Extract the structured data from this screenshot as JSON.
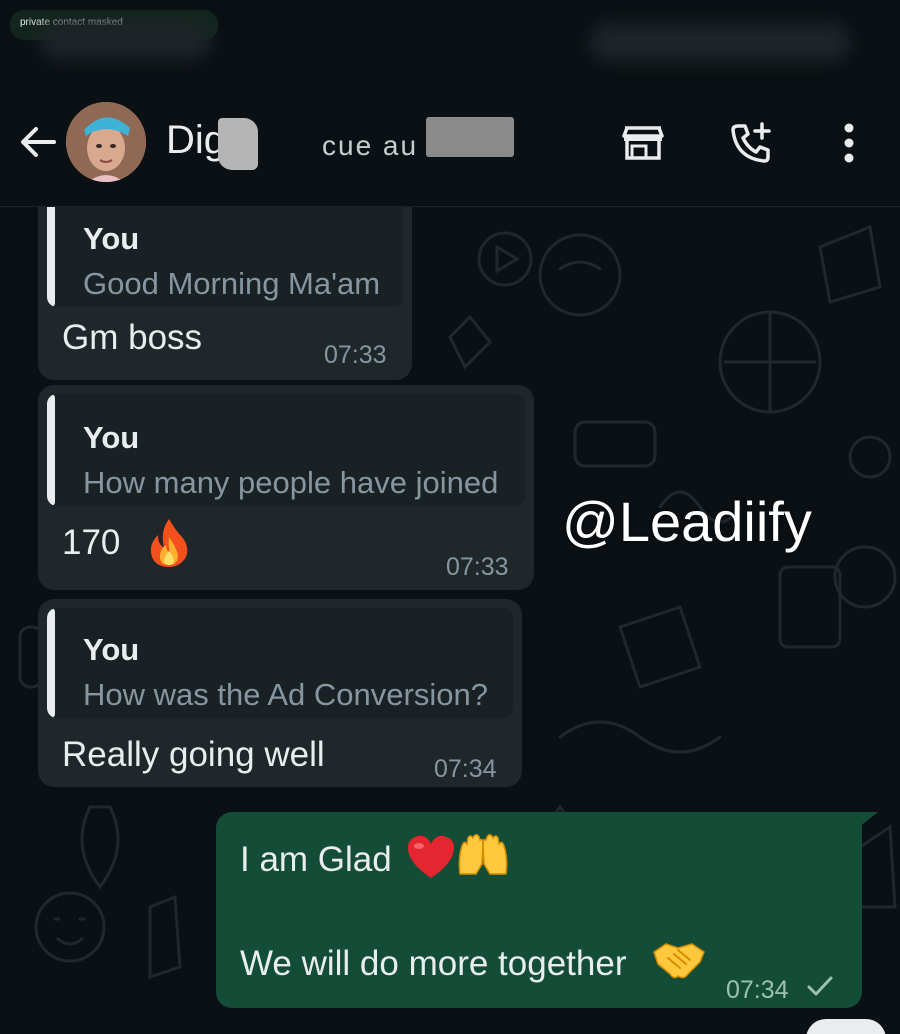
{
  "status_bar": {
    "masked_label": "private contact masked"
  },
  "header": {
    "contact_name": "Digi",
    "redacted_fragment": "cue au",
    "icons": [
      "back-arrow-icon",
      "avatar",
      "store-icon",
      "add-call-icon",
      "more-vert-icon"
    ]
  },
  "watermark": "@Leadiify",
  "messages": [
    {
      "quote_author": "You",
      "quote_text": "Good Morning Ma'am",
      "text": "Gm boss",
      "time": "07:33"
    },
    {
      "quote_author": "You",
      "quote_text": "How many people have joined",
      "text": "170",
      "emoji": "fire-emoji",
      "time": "07:33"
    },
    {
      "quote_author": "You",
      "quote_text": "How was the Ad Conversion?",
      "text": "Really going well",
      "time": "07:34"
    }
  ],
  "outgoing": {
    "line1": "I am Glad",
    "line1_emojis": [
      "red-heart-emoji",
      "raising-hands-emoji"
    ],
    "line2": "We will do more together",
    "line2_emoji": "handshake-emoji",
    "time": "07:34",
    "status": "sent-check-icon"
  },
  "colors": {
    "background": "#0b1014",
    "incoming_bubble": "#1f272a",
    "outgoing_bubble": "#144d37",
    "secondary_text": "#8696a0"
  }
}
